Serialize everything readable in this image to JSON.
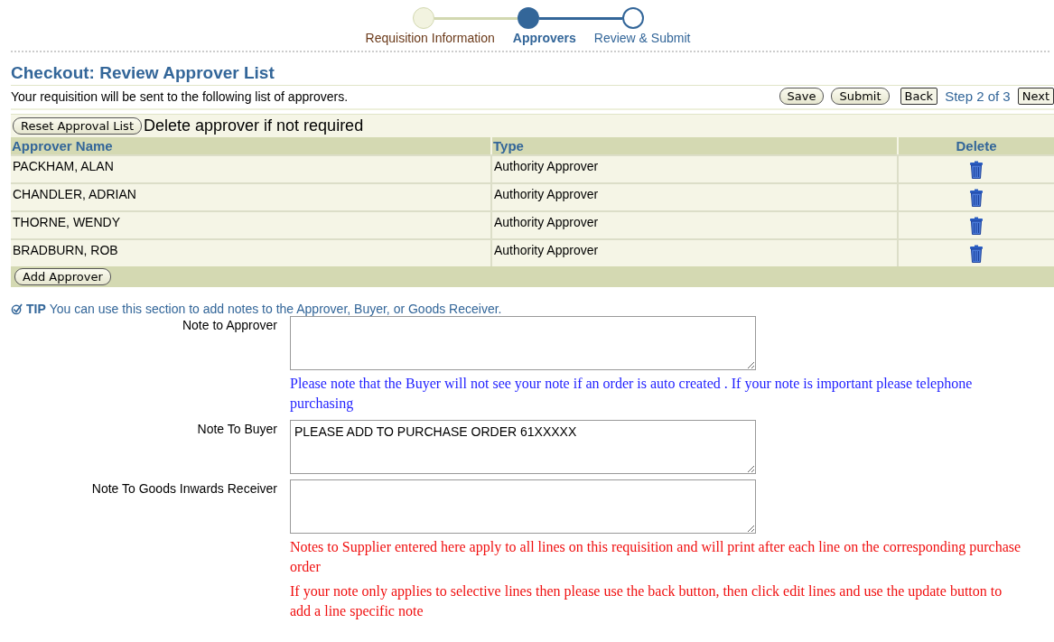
{
  "train": [
    {
      "label": "Requisition Information",
      "completed": true,
      "selected": false
    },
    {
      "label": "Approvers",
      "completed": false,
      "selected": true
    },
    {
      "label": "Review & Submit",
      "completed": false,
      "selected": false
    }
  ],
  "page_title": "Checkout: Review Approver List",
  "intro": "Your requisition will be sent to the following list of approvers.",
  "nav": {
    "buttons": [
      "Save",
      "Submit"
    ],
    "back": "Back",
    "step": "Step 2 of 3",
    "next": "Next"
  },
  "table": {
    "reset_button": "Reset Approval List",
    "hint": "Delete approver if not required",
    "columns": [
      "Approver Name",
      "Type",
      "Delete"
    ],
    "rows": [
      {
        "name": "PACKHAM, ALAN",
        "type": "Authority Approver"
      },
      {
        "name": "CHANDLER, ADRIAN",
        "type": "Authority Approver"
      },
      {
        "name": "THORNE, WENDY",
        "type": "Authority Approver"
      },
      {
        "name": "BRADBURN, ROB",
        "type": "Authority Approver"
      }
    ],
    "add_button": "Add Approver"
  },
  "tip": {
    "label": "TIP",
    "text": "You can use this section to add notes to the Approver, Buyer, or Goods Receiver."
  },
  "notes": [
    {
      "label": "Note to Approver",
      "messages": [
        {
          "kind": "info",
          "text": "Please note that the Buyer will not see your note if an order is auto created . If your note is important please telephone purchasing"
        }
      ]
    },
    {
      "label": "Note To Buyer",
      "value": "PLEASE ADD TO PURCHASE ORDER 61XXXXX"
    },
    {
      "label": "Note To Goods Inwards Receiver",
      "messages": [
        {
          "kind": "warning",
          "text": "Notes to Supplier entered here apply to all lines on this requisition and will print after each line on the corresponding purchase order"
        },
        {
          "kind": "warning",
          "text": "If your note only applies to selective lines then please use the back button, then click edit lines and use the update button to add a line specific note"
        }
      ]
    }
  ]
}
